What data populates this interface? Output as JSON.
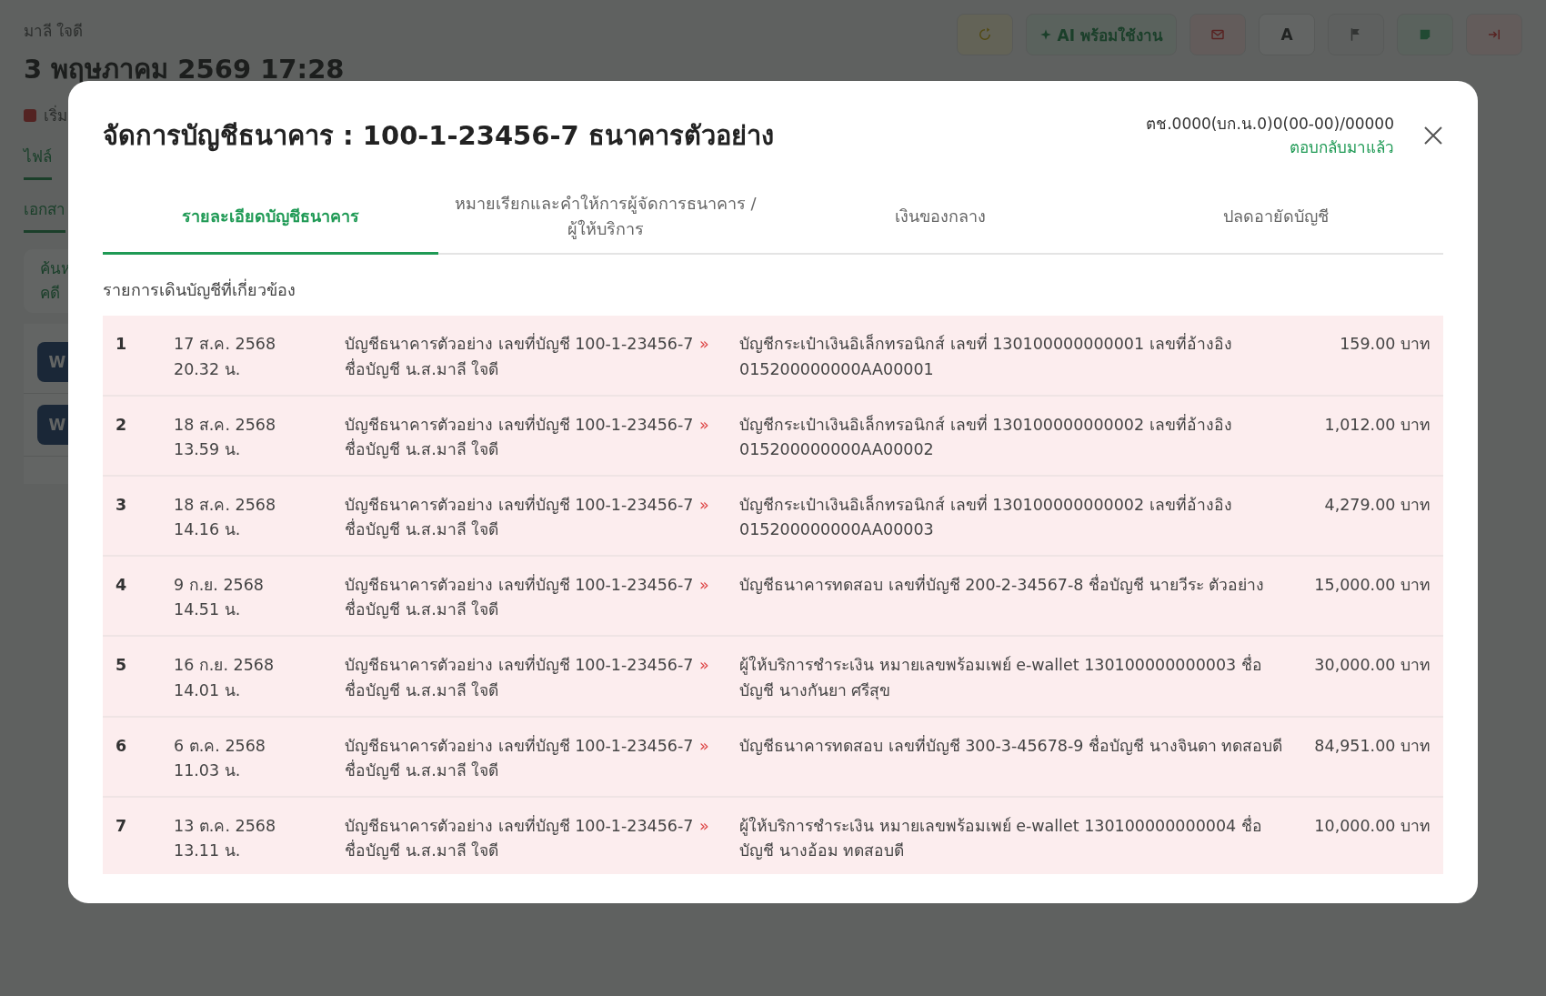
{
  "background": {
    "user_name": "มาลี ใจดี",
    "datetime": "3 พฤษภาคม 2569 17:28",
    "toolbar": [
      {
        "kind": "icon"
      },
      {
        "kind": "ai",
        "label": "AI พร้อมใช้งาน"
      },
      {
        "kind": "icon"
      },
      {
        "kind": "text",
        "label": "A"
      },
      {
        "kind": "icon"
      },
      {
        "kind": "icon"
      },
      {
        "kind": "icon"
      }
    ],
    "status_label": "เริ่ม",
    "tabs": [
      {
        "label": "ไฟล์",
        "selected": true
      },
      {
        "label": "เอกสา",
        "selected": true
      }
    ],
    "search_lines": [
      "ค้นห",
      "คดี"
    ],
    "items": [
      {
        "badge": "W"
      },
      {
        "badge": "W"
      }
    ]
  },
  "dialog": {
    "title": "จัดการบัญชีธนาคาร : 100-1-23456-7 ธนาคารตัวอย่าง",
    "case_number": "ตช.0000(บก.น.0)0(00-00)/00000",
    "case_status": "ตอบกลับมาแล้ว",
    "tabs": [
      {
        "label": "รายละเอียดบัญชีธนาคาร",
        "selected": true
      },
      {
        "label": "หมายเรียกและคำให้การผู้จัดการธนาคาร / ผู้ให้บริการ",
        "selected": false
      },
      {
        "label": "เงินของกลาง",
        "selected": false
      },
      {
        "label": "ปลดอายัดบัญชี",
        "selected": false
      }
    ],
    "section_title": "รายการเดินบัญชีที่เกี่ยวข้อง",
    "transactions": [
      {
        "no": "1",
        "date": "17 ส.ค. 2568",
        "time": "20.32 น.",
        "from": "บัญชีธนาคารตัวอย่าง เลขที่บัญชี 100-1-23456-7 ชื่อบัญชี น.ส.มาลี ใจดี",
        "arrow": "»",
        "to": "บัญชีกระเป๋าเงินอิเล็กทรอนิกส์ เลขที่ 130100000000001 เลขที่อ้างอิง 015200000000AA00001",
        "amount": "159.00 บาท"
      },
      {
        "no": "2",
        "date": "18 ส.ค. 2568",
        "time": "13.59 น.",
        "from": "บัญชีธนาคารตัวอย่าง เลขที่บัญชี 100-1-23456-7 ชื่อบัญชี น.ส.มาลี ใจดี",
        "arrow": "»",
        "to": "บัญชีกระเป๋าเงินอิเล็กทรอนิกส์ เลขที่ 130100000000002 เลขที่อ้างอิง 015200000000AA00002",
        "amount": "1,012.00 บาท"
      },
      {
        "no": "3",
        "date": "18 ส.ค. 2568",
        "time": "14.16 น.",
        "from": "บัญชีธนาคารตัวอย่าง เลขที่บัญชี 100-1-23456-7 ชื่อบัญชี น.ส.มาลี ใจดี",
        "arrow": "»",
        "to": "บัญชีกระเป๋าเงินอิเล็กทรอนิกส์ เลขที่ 130100000000002 เลขที่อ้างอิง 015200000000AA00003",
        "amount": "4,279.00 บาท"
      },
      {
        "no": "4",
        "date": "9 ก.ย. 2568",
        "time": "14.51 น.",
        "from": "บัญชีธนาคารตัวอย่าง เลขที่บัญชี 100-1-23456-7 ชื่อบัญชี น.ส.มาลี ใจดี",
        "arrow": "»",
        "to": "บัญชีธนาคารทดสอบ เลขที่บัญชี 200-2-34567-8 ชื่อบัญชี นายวีระ ตัวอย่าง",
        "amount": "15,000.00 บาท"
      },
      {
        "no": "5",
        "date": "16 ก.ย. 2568",
        "time": "14.01 น.",
        "from": "บัญชีธนาคารตัวอย่าง เลขที่บัญชี 100-1-23456-7 ชื่อบัญชี น.ส.มาลี ใจดี",
        "arrow": "»",
        "to": "ผู้ให้บริการชำระเงิน หมายเลขพร้อมเพย์ e-wallet 130100000000003 ชื่อบัญชี นางกันยา ศรีสุข",
        "amount": "30,000.00 บาท"
      },
      {
        "no": "6",
        "date": "6 ต.ค. 2568",
        "time": "11.03 น.",
        "from": "บัญชีธนาคารตัวอย่าง เลขที่บัญชี 100-1-23456-7 ชื่อบัญชี น.ส.มาลี ใจดี",
        "arrow": "»",
        "to": "บัญชีธนาคารทดสอบ เลขที่บัญชี 300-3-45678-9 ชื่อบัญชี นางจินดา ทดสอบดี",
        "amount": "84,951.00 บาท"
      },
      {
        "no": "7",
        "date": "13 ต.ค. 2568",
        "time": "13.11 น.",
        "from": "บัญชีธนาคารตัวอย่าง เลขที่บัญชี 100-1-23456-7 ชื่อบัญชี น.ส.มาลี ใจดี",
        "arrow": "»",
        "to": "ผู้ให้บริการชำระเงิน หมายเลขพร้อมเพย์ e-wallet 130100000000004 ชื่อบัญชี นางอ้อม ทดสอบดี",
        "amount": "10,000.00 บาท"
      }
    ]
  }
}
